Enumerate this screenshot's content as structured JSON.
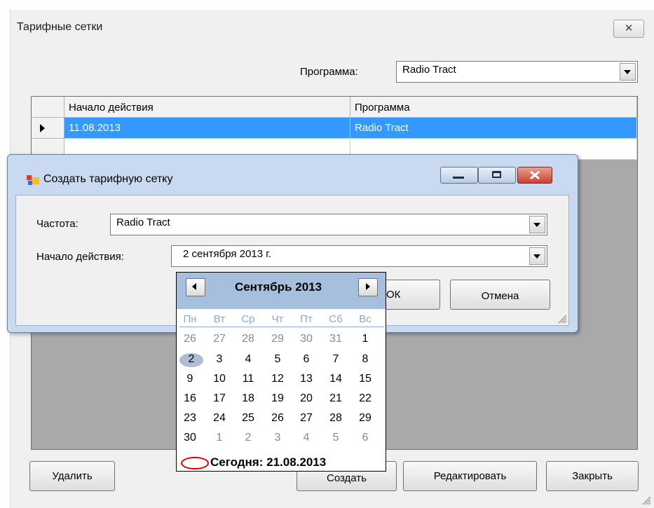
{
  "main_window": {
    "title": "Тарифные сетки",
    "close_glyph": "✕",
    "program_label": "Программа:",
    "program_value": "Radio Tract",
    "grid": {
      "columns": [
        "Начало действия",
        "Программа"
      ],
      "rows": [
        {
          "start": "11.08.2013",
          "program": "Radio Tract"
        }
      ]
    },
    "buttons": {
      "delete": "Удалить",
      "create": "Создать",
      "edit": "Редактировать",
      "close": "Закрыть"
    }
  },
  "dialog": {
    "title": "Создать тарифную сетку",
    "frequency_label": "Частота:",
    "frequency_value": "Radio Tract",
    "start_label": "Начало действия:",
    "start_value": "2 сентября 2013 г.",
    "ok_label": "ОК",
    "cancel_label": "Отмена"
  },
  "calendar": {
    "month": "Сентябрь 2013",
    "weekdays": [
      "Пн",
      "Вт",
      "Ср",
      "Чт",
      "Пт",
      "Сб",
      "Вс"
    ],
    "weeks": [
      [
        "26",
        "27",
        "28",
        "29",
        "30",
        "31",
        "1"
      ],
      [
        "2",
        "3",
        "4",
        "5",
        "6",
        "7",
        "8"
      ],
      [
        "9",
        "10",
        "11",
        "12",
        "13",
        "14",
        "15"
      ],
      [
        "16",
        "17",
        "18",
        "19",
        "20",
        "21",
        "22"
      ],
      [
        "23",
        "24",
        "25",
        "26",
        "27",
        "28",
        "29"
      ],
      [
        "30",
        "1",
        "2",
        "3",
        "4",
        "5",
        "6"
      ]
    ],
    "selected_day": "2",
    "today_text": "Сегодня: 21.08.2013"
  },
  "colors": {
    "selection_row": "#3399ff",
    "calendar_header": "#a5bfdc",
    "dialog_frame": "#c9daf0",
    "close_button_red": "#c8442f"
  }
}
